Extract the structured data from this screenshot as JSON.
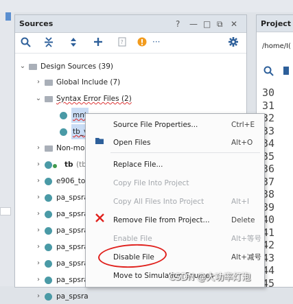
{
  "sources_panel": {
    "title": "Sources",
    "controls": [
      "?",
      "—",
      "□",
      "⧉",
      "✕"
    ],
    "toolbar_more": "···",
    "tree": {
      "design_sources": "Design Sources (39)",
      "global_include": "Global Include (7)",
      "syntax_error_files": "Syntax Error Files (2)",
      "file_1": "mnt",
      "file_2": "tb_v",
      "non_module": "Non-moc",
      "tb": "tb",
      "tb_suffix": "(tb",
      "e906": "e906_top",
      "pa_rows": [
        "pa_spsra",
        "pa_spsra",
        "pa_spsra",
        "pa_spsra",
        "pa_spsra",
        "pa_spsra",
        "pa_spsra"
      ]
    }
  },
  "project_panel": {
    "title": "Project",
    "path": "/home/I(",
    "line_numbers": [
      "30",
      "31",
      "32",
      "33",
      "34",
      "35",
      "36",
      "37",
      "38",
      "39",
      "40",
      "41",
      "42",
      "43",
      "44",
      "45"
    ]
  },
  "context_menu": {
    "items": [
      {
        "label": "Source File Properties...",
        "shortcut": "Ctrl+E",
        "enabled": true
      },
      {
        "label": "Open Files",
        "shortcut": "Alt+O",
        "enabled": true
      },
      {
        "label": "Replace File...",
        "shortcut": "",
        "enabled": true
      },
      {
        "label": "Copy File Into Project",
        "shortcut": "",
        "enabled": false
      },
      {
        "label": "Copy All Files Into Project",
        "shortcut": "Alt+I",
        "enabled": false
      },
      {
        "label": "Remove File from Project...",
        "shortcut": "Delete",
        "enabled": true
      },
      {
        "label": "Enable File",
        "shortcut": "Alt+等号",
        "enabled": false
      },
      {
        "label": "Disable File",
        "shortcut": "Alt+减号",
        "enabled": true
      },
      {
        "label": "Move to Simulation Sources",
        "shortcut": "",
        "enabled": true
      }
    ]
  },
  "watermark": "CSDN @大功率灯泡",
  "colors": {
    "accent": "#2d5f9a",
    "selection": "#c9dcf5",
    "annotation": "#e0201c",
    "warning": "#f29b1d"
  }
}
